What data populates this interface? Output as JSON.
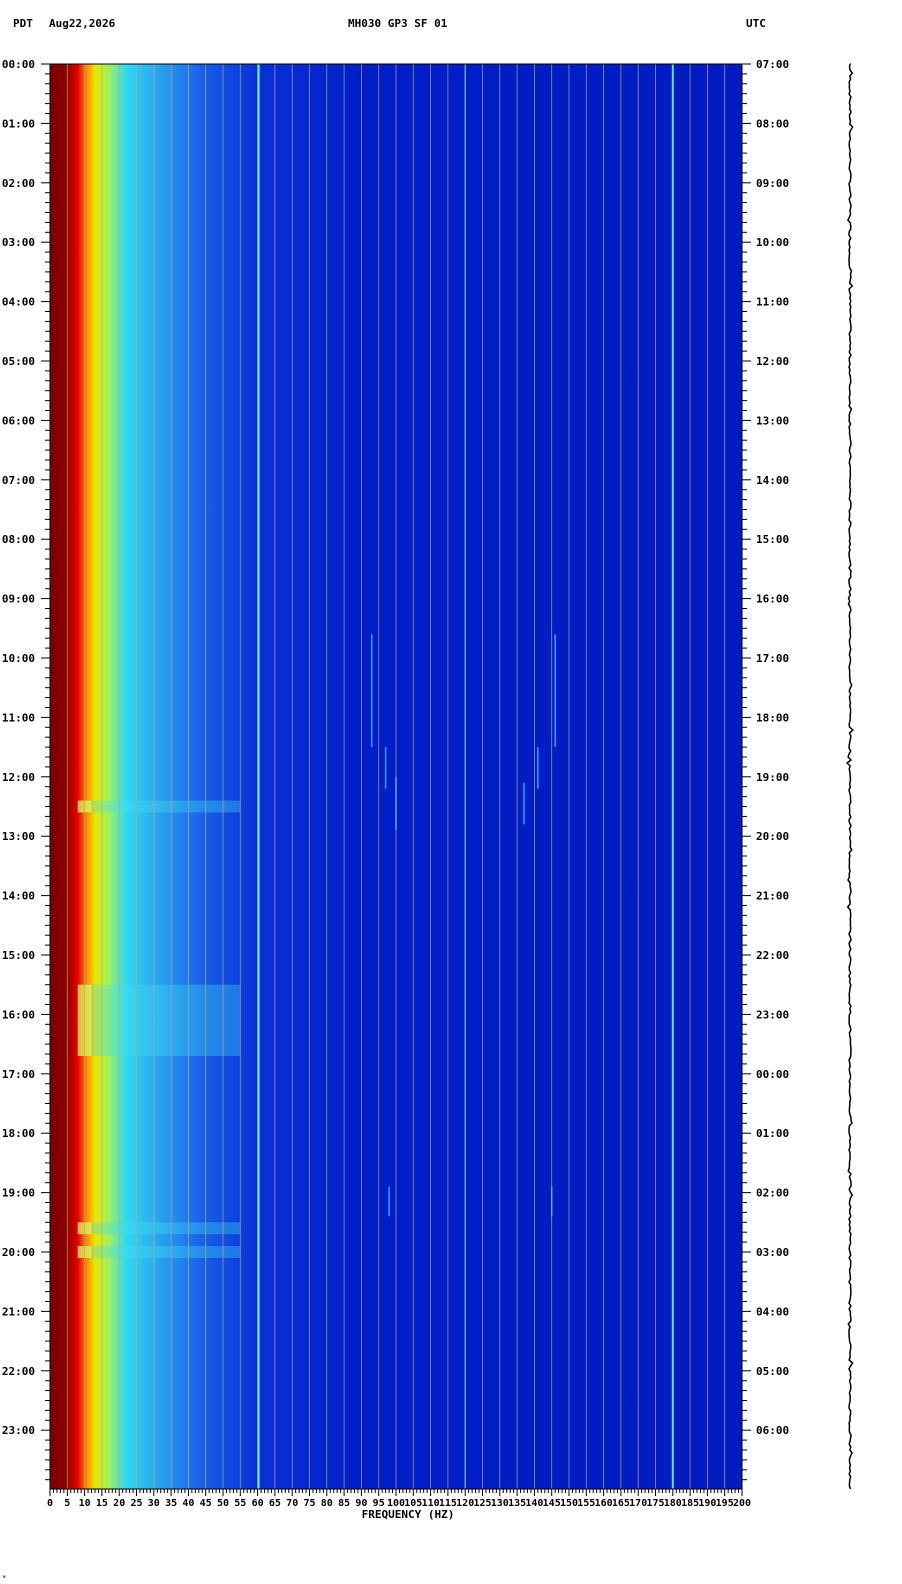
{
  "header": {
    "left_tz": "PDT",
    "date": "Aug22,2026",
    "title": "MH030 GP3 SF 01",
    "right_tz": "UTC"
  },
  "footer_mark": "*",
  "chart_data": {
    "type": "heatmap",
    "title": "MH030 GP3 SF 01",
    "xlabel": "FREQUENCY (HZ)",
    "xlim": [
      0,
      200
    ],
    "x_tick_labels": [
      "0",
      "5",
      "10",
      "15",
      "20",
      "25",
      "30",
      "35",
      "40",
      "45",
      "50",
      "55",
      "60",
      "65",
      "70",
      "75",
      "80",
      "85",
      "90",
      "95",
      "100",
      "105",
      "110",
      "115",
      "120",
      "125",
      "130",
      "135",
      "140",
      "145",
      "150",
      "155",
      "160",
      "165",
      "170",
      "175",
      "180",
      "185",
      "190",
      "195",
      "200"
    ],
    "y_left_label": "PDT",
    "y_right_label": "UTC",
    "y_left_tick_labels": [
      "00:00",
      "01:00",
      "02:00",
      "03:00",
      "04:00",
      "05:00",
      "06:00",
      "07:00",
      "08:00",
      "09:00",
      "10:00",
      "11:00",
      "12:00",
      "13:00",
      "14:00",
      "15:00",
      "16:00",
      "17:00",
      "18:00",
      "19:00",
      "20:00",
      "21:00",
      "22:00",
      "23:00"
    ],
    "y_right_tick_labels": [
      "07:00",
      "08:00",
      "09:00",
      "10:00",
      "11:00",
      "12:00",
      "13:00",
      "14:00",
      "15:00",
      "16:00",
      "17:00",
      "18:00",
      "19:00",
      "20:00",
      "21:00",
      "22:00",
      "23:00",
      "00:00",
      "01:00",
      "02:00",
      "03:00",
      "04:00",
      "05:00",
      "06:00"
    ],
    "ylim_hours": [
      0,
      25
    ],
    "grid": "vertical every 5 Hz",
    "colormap": [
      "#800000",
      "#ff0000",
      "#ffff00",
      "#00ffff",
      "#0000ff",
      "#00008b"
    ],
    "spectral_lines_hz": [
      60,
      120,
      180
    ],
    "high_noise_hours_pdt": [
      [
        12.4,
        12.6
      ],
      [
        15.5,
        16.7
      ],
      [
        19.5,
        19.7
      ],
      [
        19.9,
        20.1
      ]
    ]
  }
}
